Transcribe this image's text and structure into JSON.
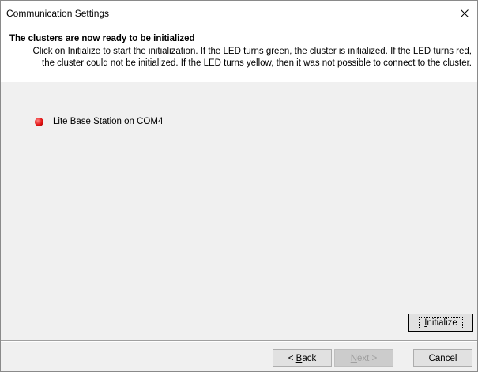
{
  "window": {
    "title": "Communication Settings"
  },
  "header": {
    "title": "The clusters are now ready to be initialized",
    "description_line1": "Click on Initialize to start the initialization. If the LED turns green, the cluster is initialized. If the LED turns red,",
    "description_line2": "the cluster could not be initialized. If the LED turns yellow, then it was not possible to connect to the cluster."
  },
  "clusters": [
    {
      "label": "Lite Base Station on COM4",
      "led_status": "red",
      "led_color": "#e01010"
    }
  ],
  "buttons": {
    "initialize": {
      "prefix": "",
      "mnemonic": "I",
      "rest": "nitialize"
    },
    "back": {
      "prefix": "< ",
      "mnemonic": "B",
      "rest": "ack"
    },
    "next": {
      "prefix": "",
      "mnemonic": "N",
      "rest": "ext >",
      "enabled": false
    },
    "cancel": {
      "label": "Cancel"
    }
  },
  "colors": {
    "dialog_background": "#f0f0f0",
    "header_background": "#ffffff",
    "button_face": "#e1e1e1",
    "disabled_text": "#a0a0a0"
  },
  "icons": {
    "close": "close-icon",
    "led": "led-indicator-icon"
  }
}
